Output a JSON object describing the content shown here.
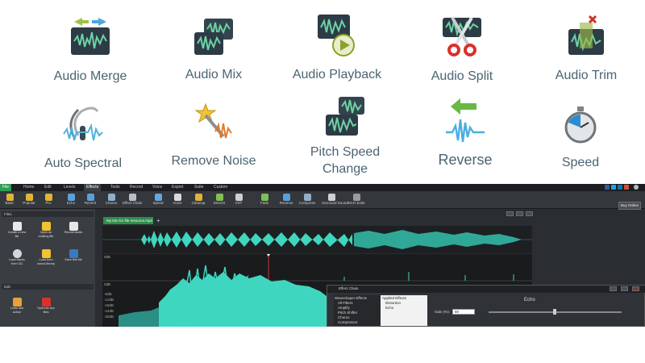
{
  "features": [
    {
      "id": "audio-merge",
      "label": "Audio Merge",
      "icon": "audio-merge-icon"
    },
    {
      "id": "audio-mix",
      "label": "Audio Mix",
      "icon": "audio-mix-icon"
    },
    {
      "id": "audio-playback",
      "label": "Audio Playback",
      "icon": "audio-playback-icon"
    },
    {
      "id": "audio-split",
      "label": "Audio Split",
      "icon": "scissors-icon"
    },
    {
      "id": "audio-trim",
      "label": "Audio Trim",
      "icon": "audio-trim-icon"
    },
    {
      "id": "auto-spectral",
      "label": "Auto Spectral",
      "icon": "spectral-icon"
    },
    {
      "id": "remove-noise",
      "label": "Remove Noise",
      "icon": "magic-wand-icon"
    },
    {
      "id": "pitch-speed-change",
      "label_line1": "Pitch Speed",
      "label_line2": "Change",
      "icon": "pitch-speed-icon"
    },
    {
      "id": "reverse",
      "label": "Reverse",
      "icon": "reverse-arrow-icon"
    },
    {
      "id": "speed",
      "label": "Speed",
      "icon": "stopwatch-icon"
    }
  ],
  "app": {
    "menus": [
      "File",
      "Home",
      "Edit",
      "Levels",
      "Effects",
      "Tools",
      "Record",
      "Voice",
      "Export",
      "Suite",
      "Custom"
    ],
    "active_menu": "Effects",
    "toolbar_left": [
      "Basic",
      "Popular",
      "Pro",
      "Echo",
      "Reverb",
      "Chorus",
      "Effect Chain",
      "Speed",
      "Voice",
      "Cleanup",
      "DirectX",
      "VST"
    ],
    "toolbar_right": [
      "Fade",
      "Reverse",
      "Compress",
      "Surround Sound",
      "NCH Suite"
    ],
    "buy_online": "Buy Online",
    "files_header": "Files",
    "file_buttons": [
      "Create a new file",
      "Open an existing file",
      "Record audio",
      "Load tracks from CD",
      "Load from sound library",
      "Save this file"
    ],
    "edit_header": "Edit",
    "edit_buttons": [
      "Undo last action",
      "Split into two files"
    ],
    "file_tab": "My trim for file resource.mp3",
    "add_tab": "+",
    "db_labels": [
      "0dB",
      "-6dB",
      "-12dB",
      "-18dB",
      "-24dB",
      "-30dB"
    ],
    "dialog": {
      "title": "Effect Chain",
      "effects_header": "Waveshaper Effects",
      "effects": [
        "All Filters",
        "Amplify",
        "Pitch Shifter",
        "Chorus",
        "Compressor"
      ],
      "applied_header": "Applied Effects",
      "applied": [
        "Distortion",
        "Echo"
      ],
      "panel_title": "Echo",
      "gain_label": "Gain (%):",
      "gain_value": "50"
    },
    "colors": {
      "waveform": "#3fd6c0",
      "accent_green": "#2e8f4b",
      "cursor": "#d03030"
    }
  }
}
